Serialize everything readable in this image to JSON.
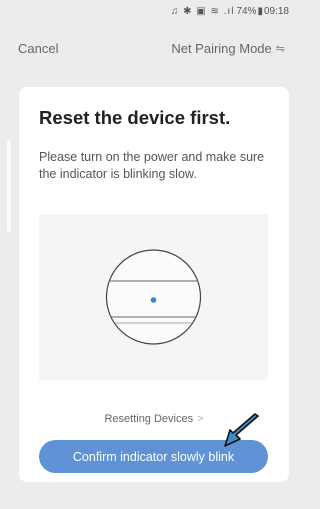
{
  "status_bar": {
    "icons": "♫ ✱ ▣ ≋ .ıl",
    "battery": "74%",
    "time": "09:18"
  },
  "nav": {
    "cancel_label": "Cancel",
    "mode_label": "Net Pairing Mode",
    "swap_icon": "⇋"
  },
  "card": {
    "title": "Reset the device first.",
    "description": "Please turn on the power and make sure the indicator is blinking slow.",
    "resetting_link": "Resetting Devices",
    "chevron": ">",
    "confirm_label": "Confirm indicator slowly blink"
  },
  "colors": {
    "accent": "#5f93d6",
    "indicator": "#3f7fd9",
    "arrow_fill": "#3b8fd1"
  }
}
